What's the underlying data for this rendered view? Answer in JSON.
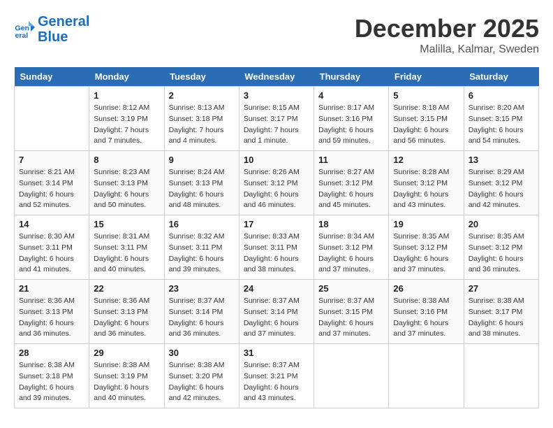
{
  "header": {
    "logo_line1": "General",
    "logo_line2": "Blue",
    "month": "December 2025",
    "location": "Malilla, Kalmar, Sweden"
  },
  "weekdays": [
    "Sunday",
    "Monday",
    "Tuesday",
    "Wednesday",
    "Thursday",
    "Friday",
    "Saturday"
  ],
  "weeks": [
    [
      {
        "day": "",
        "info": ""
      },
      {
        "day": "1",
        "info": "Sunrise: 8:12 AM\nSunset: 3:19 PM\nDaylight: 7 hours\nand 7 minutes."
      },
      {
        "day": "2",
        "info": "Sunrise: 8:13 AM\nSunset: 3:18 PM\nDaylight: 7 hours\nand 4 minutes."
      },
      {
        "day": "3",
        "info": "Sunrise: 8:15 AM\nSunset: 3:17 PM\nDaylight: 7 hours\nand 1 minute."
      },
      {
        "day": "4",
        "info": "Sunrise: 8:17 AM\nSunset: 3:16 PM\nDaylight: 6 hours\nand 59 minutes."
      },
      {
        "day": "5",
        "info": "Sunrise: 8:18 AM\nSunset: 3:15 PM\nDaylight: 6 hours\nand 56 minutes."
      },
      {
        "day": "6",
        "info": "Sunrise: 8:20 AM\nSunset: 3:15 PM\nDaylight: 6 hours\nand 54 minutes."
      }
    ],
    [
      {
        "day": "7",
        "info": "Sunrise: 8:21 AM\nSunset: 3:14 PM\nDaylight: 6 hours\nand 52 minutes."
      },
      {
        "day": "8",
        "info": "Sunrise: 8:23 AM\nSunset: 3:13 PM\nDaylight: 6 hours\nand 50 minutes."
      },
      {
        "day": "9",
        "info": "Sunrise: 8:24 AM\nSunset: 3:13 PM\nDaylight: 6 hours\nand 48 minutes."
      },
      {
        "day": "10",
        "info": "Sunrise: 8:26 AM\nSunset: 3:12 PM\nDaylight: 6 hours\nand 46 minutes."
      },
      {
        "day": "11",
        "info": "Sunrise: 8:27 AM\nSunset: 3:12 PM\nDaylight: 6 hours\nand 45 minutes."
      },
      {
        "day": "12",
        "info": "Sunrise: 8:28 AM\nSunset: 3:12 PM\nDaylight: 6 hours\nand 43 minutes."
      },
      {
        "day": "13",
        "info": "Sunrise: 8:29 AM\nSunset: 3:12 PM\nDaylight: 6 hours\nand 42 minutes."
      }
    ],
    [
      {
        "day": "14",
        "info": "Sunrise: 8:30 AM\nSunset: 3:11 PM\nDaylight: 6 hours\nand 41 minutes."
      },
      {
        "day": "15",
        "info": "Sunrise: 8:31 AM\nSunset: 3:11 PM\nDaylight: 6 hours\nand 40 minutes."
      },
      {
        "day": "16",
        "info": "Sunrise: 8:32 AM\nSunset: 3:11 PM\nDaylight: 6 hours\nand 39 minutes."
      },
      {
        "day": "17",
        "info": "Sunrise: 8:33 AM\nSunset: 3:11 PM\nDaylight: 6 hours\nand 38 minutes."
      },
      {
        "day": "18",
        "info": "Sunrise: 8:34 AM\nSunset: 3:12 PM\nDaylight: 6 hours\nand 37 minutes."
      },
      {
        "day": "19",
        "info": "Sunrise: 8:35 AM\nSunset: 3:12 PM\nDaylight: 6 hours\nand 37 minutes."
      },
      {
        "day": "20",
        "info": "Sunrise: 8:35 AM\nSunset: 3:12 PM\nDaylight: 6 hours\nand 36 minutes."
      }
    ],
    [
      {
        "day": "21",
        "info": "Sunrise: 8:36 AM\nSunset: 3:13 PM\nDaylight: 6 hours\nand 36 minutes."
      },
      {
        "day": "22",
        "info": "Sunrise: 8:36 AM\nSunset: 3:13 PM\nDaylight: 6 hours\nand 36 minutes."
      },
      {
        "day": "23",
        "info": "Sunrise: 8:37 AM\nSunset: 3:14 PM\nDaylight: 6 hours\nand 36 minutes."
      },
      {
        "day": "24",
        "info": "Sunrise: 8:37 AM\nSunset: 3:14 PM\nDaylight: 6 hours\nand 37 minutes."
      },
      {
        "day": "25",
        "info": "Sunrise: 8:37 AM\nSunset: 3:15 PM\nDaylight: 6 hours\nand 37 minutes."
      },
      {
        "day": "26",
        "info": "Sunrise: 8:38 AM\nSunset: 3:16 PM\nDaylight: 6 hours\nand 37 minutes."
      },
      {
        "day": "27",
        "info": "Sunrise: 8:38 AM\nSunset: 3:17 PM\nDaylight: 6 hours\nand 38 minutes."
      }
    ],
    [
      {
        "day": "28",
        "info": "Sunrise: 8:38 AM\nSunset: 3:18 PM\nDaylight: 6 hours\nand 39 minutes."
      },
      {
        "day": "29",
        "info": "Sunrise: 8:38 AM\nSunset: 3:19 PM\nDaylight: 6 hours\nand 40 minutes."
      },
      {
        "day": "30",
        "info": "Sunrise: 8:38 AM\nSunset: 3:20 PM\nDaylight: 6 hours\nand 42 minutes."
      },
      {
        "day": "31",
        "info": "Sunrise: 8:37 AM\nSunset: 3:21 PM\nDaylight: 6 hours\nand 43 minutes."
      },
      {
        "day": "",
        "info": ""
      },
      {
        "day": "",
        "info": ""
      },
      {
        "day": "",
        "info": ""
      }
    ]
  ]
}
